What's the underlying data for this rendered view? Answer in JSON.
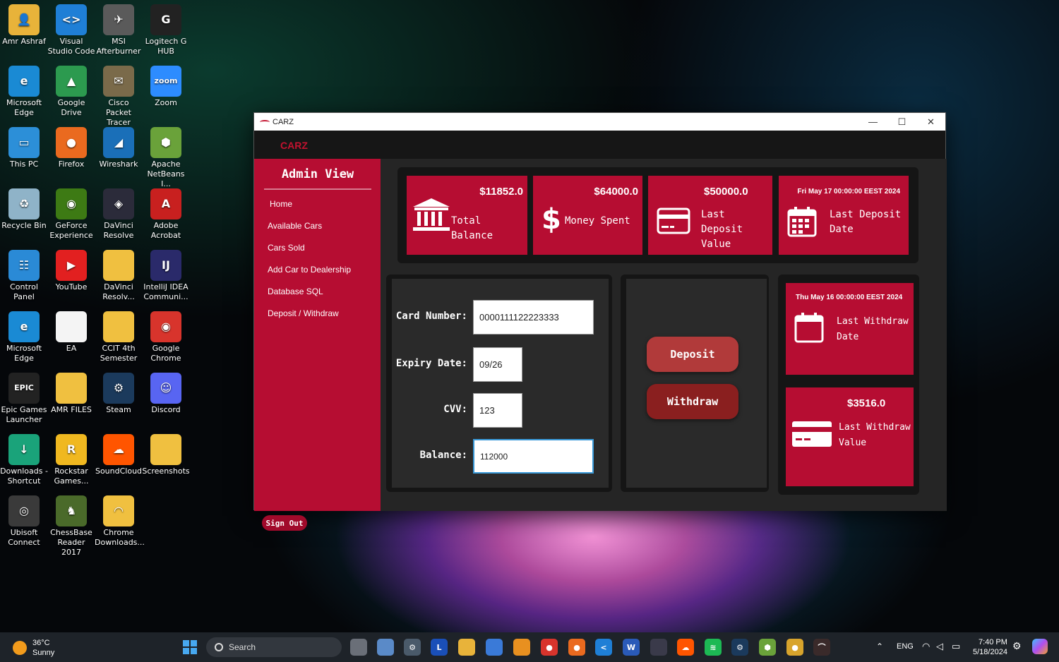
{
  "desktop": {
    "icons": [
      {
        "label": "Amr Ashraf",
        "color": "#e8b33a",
        "glyph": "👤"
      },
      {
        "label": "Visual Studio Code",
        "color": "#1f7fd6",
        "glyph": "<>"
      },
      {
        "label": "MSI Afterburner",
        "color": "#5a5a5a",
        "glyph": "✈"
      },
      {
        "label": "Logitech G HUB",
        "color": "#222222",
        "glyph": "G"
      },
      {
        "label": "Microsoft Edge",
        "color": "#1a8ad4",
        "glyph": "e"
      },
      {
        "label": "Google Drive",
        "color": "#2c9a4f",
        "glyph": "▲"
      },
      {
        "label": "Cisco Packet Tracer",
        "color": "#7a6a4a",
        "glyph": "✉"
      },
      {
        "label": "Zoom",
        "color": "#2d8cff",
        "glyph": "zoom"
      },
      {
        "label": "This PC",
        "color": "#2c8fd8",
        "glyph": "▭"
      },
      {
        "label": "Firefox",
        "color": "#ea6a1f",
        "glyph": "●"
      },
      {
        "label": "Wireshark",
        "color": "#1a6fb8",
        "glyph": "◢"
      },
      {
        "label": "Apache NetBeans I...",
        "color": "#6aa23a",
        "glyph": "⬢"
      },
      {
        "label": "Recycle Bin",
        "color": "#8fb3c8",
        "glyph": "♻"
      },
      {
        "label": "GeForce Experience",
        "color": "#3d7a14",
        "glyph": "◉"
      },
      {
        "label": "DaVinci Resolve",
        "color": "#2b2b3a",
        "glyph": "◈"
      },
      {
        "label": "Adobe Acrobat",
        "color": "#c8201f",
        "glyph": "A"
      },
      {
        "label": "Control Panel",
        "color": "#2a8ad6",
        "glyph": "☷"
      },
      {
        "label": "YouTube",
        "color": "#e22020",
        "glyph": "▶"
      },
      {
        "label": "DaVinci Resolv...",
        "color": "#f0c040",
        "glyph": ""
      },
      {
        "label": "IntelliJ IDEA Communi...",
        "color": "#2a2a6a",
        "glyph": "IJ"
      },
      {
        "label": "Microsoft Edge",
        "color": "#1a8ad4",
        "glyph": "e"
      },
      {
        "label": "EA",
        "color": "#f4f4f4",
        "glyph": ""
      },
      {
        "label": "CCIT 4th Semester",
        "color": "#f0c040",
        "glyph": ""
      },
      {
        "label": "Google Chrome",
        "color": "#d8342c",
        "glyph": "◉"
      },
      {
        "label": "Epic Games Launcher",
        "color": "#222222",
        "glyph": "EPIC"
      },
      {
        "label": "AMR FILES",
        "color": "#f0c040",
        "glyph": ""
      },
      {
        "label": "Steam",
        "color": "#1b3a5c",
        "glyph": "⚙"
      },
      {
        "label": "Discord",
        "color": "#5865f2",
        "glyph": "☺"
      },
      {
        "label": "Downloads - Shortcut",
        "color": "#1aa37a",
        "glyph": "↓"
      },
      {
        "label": "Rockstar Games...",
        "color": "#f0b820",
        "glyph": "R"
      },
      {
        "label": "SoundCloud",
        "color": "#ff5500",
        "glyph": "☁"
      },
      {
        "label": "Screenshots",
        "color": "#f0c040",
        "glyph": ""
      },
      {
        "label": "Ubisoft Connect",
        "color": "#3a3a3a",
        "glyph": "◎"
      },
      {
        "label": "ChessBase Reader 2017",
        "color": "#4a6a2a",
        "glyph": "♞"
      },
      {
        "label": "Chrome Downloads...",
        "color": "#f0c040",
        "glyph": "◠"
      }
    ]
  },
  "window": {
    "title": "CARZ",
    "controls": {
      "minimize": "—",
      "maximize": "☐",
      "close": "✕"
    },
    "brand": "CARZ"
  },
  "sidebar": {
    "title": "Admin View",
    "items": [
      {
        "label": "Home"
      },
      {
        "label": "Available Cars"
      },
      {
        "label": "Cars Sold"
      },
      {
        "label": "Add Car to Dealership"
      },
      {
        "label": "Database SQL"
      },
      {
        "label": "Deposit / Withdraw"
      }
    ],
    "sign_out": "Sign Out"
  },
  "stats": {
    "total_balance": {
      "value": "$11852.0",
      "label": "Total Balance",
      "icon": "bank-icon"
    },
    "money_spent": {
      "value": "$64000.0",
      "label": "Money Spent",
      "icon": "dollar-icon"
    },
    "last_deposit_value": {
      "value": "$50000.0",
      "label_1": "Last Deposit",
      "label_2": "Value",
      "icon": "credit-card-icon"
    },
    "last_deposit_date": {
      "value": "Fri May 17 00:00:00 EEST 2024",
      "label_1": "Last Deposit",
      "label_2": "Date",
      "icon": "calendar-icon"
    }
  },
  "card_form": {
    "card_number": {
      "label": "Card Number:",
      "value": "0000111122223333"
    },
    "expiry_date": {
      "label": "Expiry Date:",
      "value": "09/26"
    },
    "cvv": {
      "label": "CVV:",
      "value": "123"
    },
    "balance": {
      "label": "Balance:",
      "value": "112000"
    }
  },
  "actions": {
    "deposit": "Deposit",
    "withdraw": "Withdraw"
  },
  "withdraw_info": {
    "last_withdraw_date": {
      "value": "Thu May 16 00:00:00 EEST 2024",
      "label_1": "Last Withdraw",
      "label_2": "Date"
    },
    "last_withdraw_value": {
      "value": "$3516.0",
      "label_1": "Last Withdraw",
      "label_2": "Value"
    }
  },
  "taskbar": {
    "weather": {
      "temp": "36°C",
      "condition": "Sunny"
    },
    "search_placeholder": "Search",
    "language": "ENG",
    "time": "7:40 PM",
    "date": "5/18/2024"
  },
  "colors": {
    "accent": "#b60d32",
    "deposit_button": "#b13a3a",
    "withdraw_button": "#8a1f1f"
  }
}
